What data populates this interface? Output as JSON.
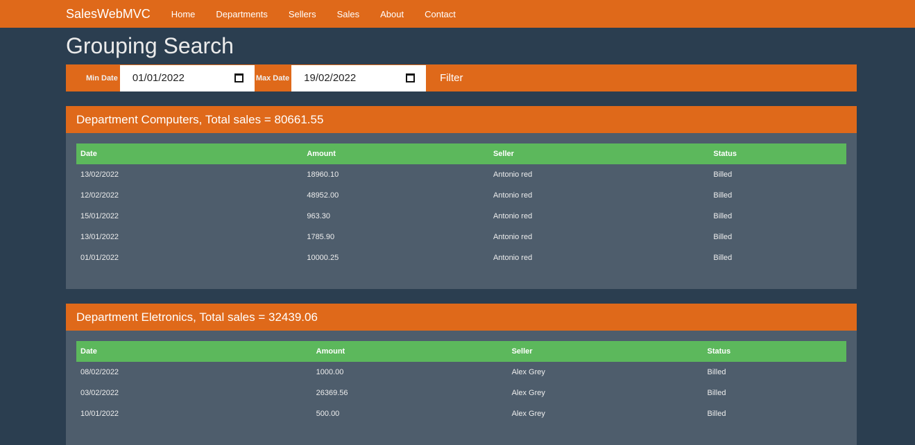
{
  "nav": {
    "brand": "SalesWebMVC",
    "links": [
      "Home",
      "Departments",
      "Sellers",
      "Sales",
      "About",
      "Contact"
    ]
  },
  "title": "Grouping Search",
  "filter": {
    "min_label": "Min Date",
    "min_value": "01/01/2022",
    "max_label": "Max Date",
    "max_value": "19/02/2022",
    "button": "Filter"
  },
  "columns": [
    "Date",
    "Amount",
    "Seller",
    "Status"
  ],
  "departments": [
    {
      "header": "Department Computers, Total sales = 80661.55",
      "rows": [
        [
          "13/02/2022",
          "18960.10",
          "Antonio red",
          "Billed"
        ],
        [
          "12/02/2022",
          "48952.00",
          "Antonio red",
          "Billed"
        ],
        [
          "15/01/2022",
          "963.30",
          "Antonio red",
          "Billed"
        ],
        [
          "13/01/2022",
          "1785.90",
          "Antonio red",
          "Billed"
        ],
        [
          "01/01/2022",
          "10000.25",
          "Antonio red",
          "Billed"
        ]
      ]
    },
    {
      "header": "Department Eletronics, Total sales = 32439.06",
      "rows": [
        [
          "08/02/2022",
          "1000.00",
          "Alex Grey",
          "Billed"
        ],
        [
          "03/02/2022",
          "26369.56",
          "Alex Grey",
          "Billed"
        ],
        [
          "10/01/2022",
          "500.00",
          "Alex Grey",
          "Billed"
        ]
      ]
    }
  ]
}
